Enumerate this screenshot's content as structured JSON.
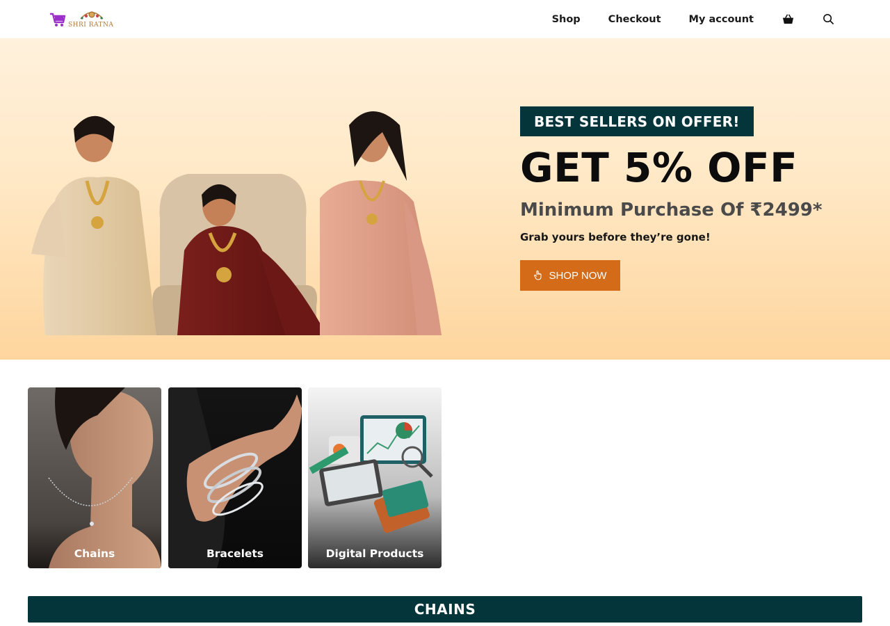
{
  "header": {
    "logo_text": "SHRI RATNA",
    "nav": [
      {
        "label": "Shop"
      },
      {
        "label": "Checkout"
      },
      {
        "label": "My account"
      }
    ],
    "icons": [
      "basket-icon",
      "search-icon"
    ]
  },
  "hero": {
    "badge": "BEST SELLERS ON OFFER!",
    "headline": "GET 5% OFF",
    "subheadline": "Minimum Purchase Of ₹2499*",
    "tagline": "Grab yours before they’re gone!",
    "cta_label": "SHOP NOW",
    "cta_icon": "pointer-hand-icon",
    "cta_color": "#d36b18",
    "badge_color": "#04353a"
  },
  "categories": [
    {
      "label": "Chains"
    },
    {
      "label": "Bracelets"
    },
    {
      "label": "Digital Products"
    }
  ],
  "section": {
    "title": "CHAINS"
  },
  "colors": {
    "accent_dark": "#04353a",
    "accent_orange": "#d36b18",
    "hero_bg_top": "#fff1dd",
    "hero_bg_bottom": "#fed59d"
  }
}
